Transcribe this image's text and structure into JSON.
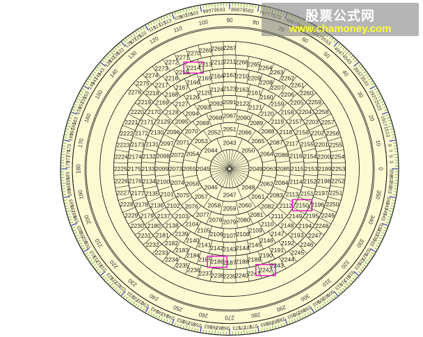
{
  "watermark": {
    "title": "股票公式网",
    "url": "www.chamoney.com"
  },
  "colors": {
    "fill": "#fcfad2",
    "line": "#1a1a1a",
    "tick": "#2a8a2a",
    "tick_major": "#1a2aa8",
    "highlight": "#e020c0",
    "deg_text": "#333333"
  },
  "rings": [
    {
      "ring": 1,
      "cells": [
        "2043",
        "2044",
        "2045",
        "2046",
        "2047",
        "2048",
        "2049",
        "2050",
        "2051",
        "2052",
        "2053",
        "2054",
        "2055",
        "2056",
        "2057",
        "2058",
        "2059",
        "2060",
        "2061",
        "2062",
        "2063",
        "2064",
        "2065",
        "2066",
        "2067",
        "2068",
        "2069",
        "2070",
        "2071",
        "2072",
        "2073",
        "2074",
        "2075",
        "2076",
        "2077",
        "2078",
        "2079",
        "2080",
        "2081",
        "2082",
        "2083",
        "2084",
        "2085",
        "2086",
        "2087",
        "2088",
        "2089",
        "2090",
        "2091",
        "2092",
        "2093",
        "2094",
        "2095",
        "2096",
        "2097",
        "2098",
        "2099",
        "2100",
        "2101",
        "2102",
        "2103",
        "2104",
        "2105",
        "2106",
        "2107",
        "2108",
        "2109",
        "2110",
        "2111",
        "2112",
        "2113",
        "2114",
        "2115",
        "2116",
        "2117",
        "2118",
        "2119",
        "2120",
        "2121",
        "2122",
        "2123",
        "2124",
        "2125",
        "2126",
        "2127",
        "2128",
        "2129",
        "2130",
        "2131",
        "2132",
        "2133",
        "2134",
        "2135",
        "2136",
        "2137",
        "2138",
        "2139",
        "2140",
        "2141",
        "2142",
        "2143",
        "2144",
        "2145",
        "2146",
        "2147",
        "2148",
        "2149",
        "2150",
        "2151",
        "2152",
        "2153",
        "2154",
        "2155",
        "2156",
        "2157",
        "2158",
        "2159",
        "2160",
        "2161",
        "2162",
        "2163",
        "2164",
        "2165",
        "2166",
        "2167",
        "2168",
        "2169",
        "2170",
        "2171",
        "2172",
        "2173",
        "2174",
        "2175",
        "2176",
        "2177",
        "2178",
        "2179",
        "2180",
        "2181",
        "2182",
        "2183",
        "2184",
        "2185",
        "2186",
        "2187",
        "2188",
        "2189",
        "2190",
        "2191",
        "2192",
        "2193",
        "2194",
        "2195",
        "2196",
        "2197",
        "2198",
        "2199",
        "2200",
        "2201",
        "2202",
        "2203",
        "2204",
        "2205",
        "2206",
        "2207",
        "2208",
        "2209",
        "2210",
        "2211",
        "2212",
        "2213",
        "2214",
        "2215",
        "2216",
        "2217",
        "2218",
        "2219",
        "2220",
        "2221",
        "2222",
        "2223",
        "2224",
        "2225",
        "2226",
        "2227",
        "2228",
        "2229",
        "2230",
        "2231",
        "2232",
        "2233",
        "2234",
        "2235",
        "2236",
        "2237",
        "2238",
        "2239",
        "2240",
        "2241",
        "2242",
        "2243",
        "2244",
        "2245",
        "2246",
        "2247",
        "2248",
        "2249",
        "2250",
        "2251",
        "2252",
        "2253",
        "2254",
        "2255",
        "2256",
        "2257",
        "2258",
        "2259",
        "2260",
        "2261",
        "2262",
        "2263",
        "2264",
        "2265",
        "2266",
        "2267",
        "2268",
        "2269",
        "2270",
        "2271",
        "2272",
        "2273",
        "2274",
        "2275",
        "2276"
      ]
    }
  ],
  "highlights": [
    "2214",
    "2242",
    "2186",
    "2150"
  ],
  "compass_labels": [
    "0",
    "10",
    "20",
    "30",
    "40",
    "50",
    "60",
    "70",
    "80",
    "90",
    "100",
    "110",
    "120",
    "130",
    "140",
    "150",
    "160",
    "170",
    "180",
    "190",
    "200",
    "210",
    "220",
    "230",
    "240",
    "250",
    "260",
    "270",
    "280",
    "290",
    "300",
    "310",
    "320",
    "330",
    "340",
    "350"
  ],
  "ring_counter_labels": [
    "1",
    "2",
    "3",
    "4",
    "5",
    "6",
    "7",
    "8",
    "9",
    "10",
    "11",
    "12",
    "13",
    "14",
    "15",
    "16",
    "17",
    "18",
    "19",
    "20",
    "21",
    "22",
    "23",
    "24",
    "25",
    "26",
    "27",
    "28",
    "29",
    "30",
    "31",
    "32",
    "33",
    "34",
    "35",
    "36",
    "37",
    "38",
    "39",
    "40",
    "41",
    "42",
    "43",
    "44",
    "45",
    "46",
    "47",
    "48",
    "49",
    "50",
    "51",
    "52",
    "53",
    "54",
    "55",
    "56",
    "57",
    "58",
    "59",
    "60",
    "61",
    "62",
    "63",
    "64",
    "65",
    "66",
    "67",
    "68",
    "69",
    "70",
    "71",
    "72",
    "73",
    "74",
    "75",
    "76",
    "77",
    "78",
    "79",
    "80",
    "81",
    "82",
    "83",
    "84",
    "85",
    "86",
    "87",
    "88",
    "89",
    "90",
    "91",
    "92",
    "93",
    "94",
    "95",
    "96",
    "97",
    "98",
    "99",
    "100",
    "101",
    "102",
    "103",
    "104",
    "105",
    "106",
    "107",
    "108",
    "109",
    "110",
    "111",
    "112",
    "113",
    "114",
    "115",
    "116",
    "117",
    "118",
    "119",
    "120",
    "121",
    "122",
    "123",
    "124",
    "125",
    "126",
    "127",
    "128",
    "129",
    "130",
    "131",
    "132",
    "133",
    "134",
    "135",
    "136",
    "137",
    "138",
    "139",
    "140",
    "141",
    "142",
    "143",
    "144",
    "145",
    "146",
    "147",
    "148",
    "149",
    "150",
    "151",
    "152",
    "153",
    "154",
    "155",
    "156",
    "157",
    "158",
    "159",
    "160",
    "161",
    "162",
    "163",
    "164",
    "165",
    "166",
    "167",
    "168",
    "169",
    "170",
    "171",
    "172",
    "173",
    "174",
    "175",
    "176",
    "177",
    "178",
    "179",
    "180",
    "181",
    "182",
    "183",
    "184",
    "185",
    "186",
    "187",
    "188",
    "189",
    "190",
    "191",
    "192",
    "193",
    "194",
    "195",
    "196",
    "197",
    "198",
    "199",
    "200",
    "201",
    "202",
    "203",
    "204",
    "205",
    "206",
    "207",
    "208",
    "209",
    "210",
    "211",
    "212",
    "213",
    "214",
    "215",
    "216",
    "217",
    "218",
    "219",
    "220",
    "221",
    "222",
    "223",
    "224",
    "225",
    "226",
    "227",
    "228",
    "229",
    "230",
    "231",
    "232",
    "233",
    "234",
    "235",
    "236",
    "237",
    "238",
    "239",
    "240",
    "241",
    "242",
    "243",
    "244",
    "245",
    "246",
    "247",
    "248",
    "249",
    "250",
    "251",
    "252",
    "253",
    "254",
    "255",
    "256",
    "257",
    "258",
    "259",
    "260",
    "261",
    "262",
    "263",
    "264",
    "265",
    "266",
    "267",
    "268",
    "269",
    "270",
    "271",
    "272",
    "273",
    "274",
    "275",
    "276",
    "277",
    "278",
    "279",
    "280",
    "281",
    "282",
    "283",
    "284",
    "285",
    "286",
    "287",
    "288",
    "289",
    "290",
    "291",
    "292",
    "293",
    "294",
    "295",
    "296",
    "297",
    "298",
    "299",
    "300",
    "301",
    "302",
    "303",
    "304",
    "305",
    "306",
    "307",
    "308",
    "309",
    "310",
    "311",
    "312",
    "313",
    "314",
    "315",
    "316",
    "317",
    "318",
    "319",
    "320",
    "321",
    "322",
    "323",
    "324",
    "325",
    "326",
    "327",
    "328",
    "329",
    "330",
    "331",
    "332",
    "333",
    "334",
    "335",
    "336",
    "337",
    "338",
    "339",
    "340",
    "341",
    "342",
    "343",
    "344",
    "345",
    "346",
    "347",
    "348",
    "349",
    "350",
    "351",
    "352",
    "353",
    "354",
    "355",
    "356",
    "357",
    "358",
    "359",
    "360"
  ]
}
